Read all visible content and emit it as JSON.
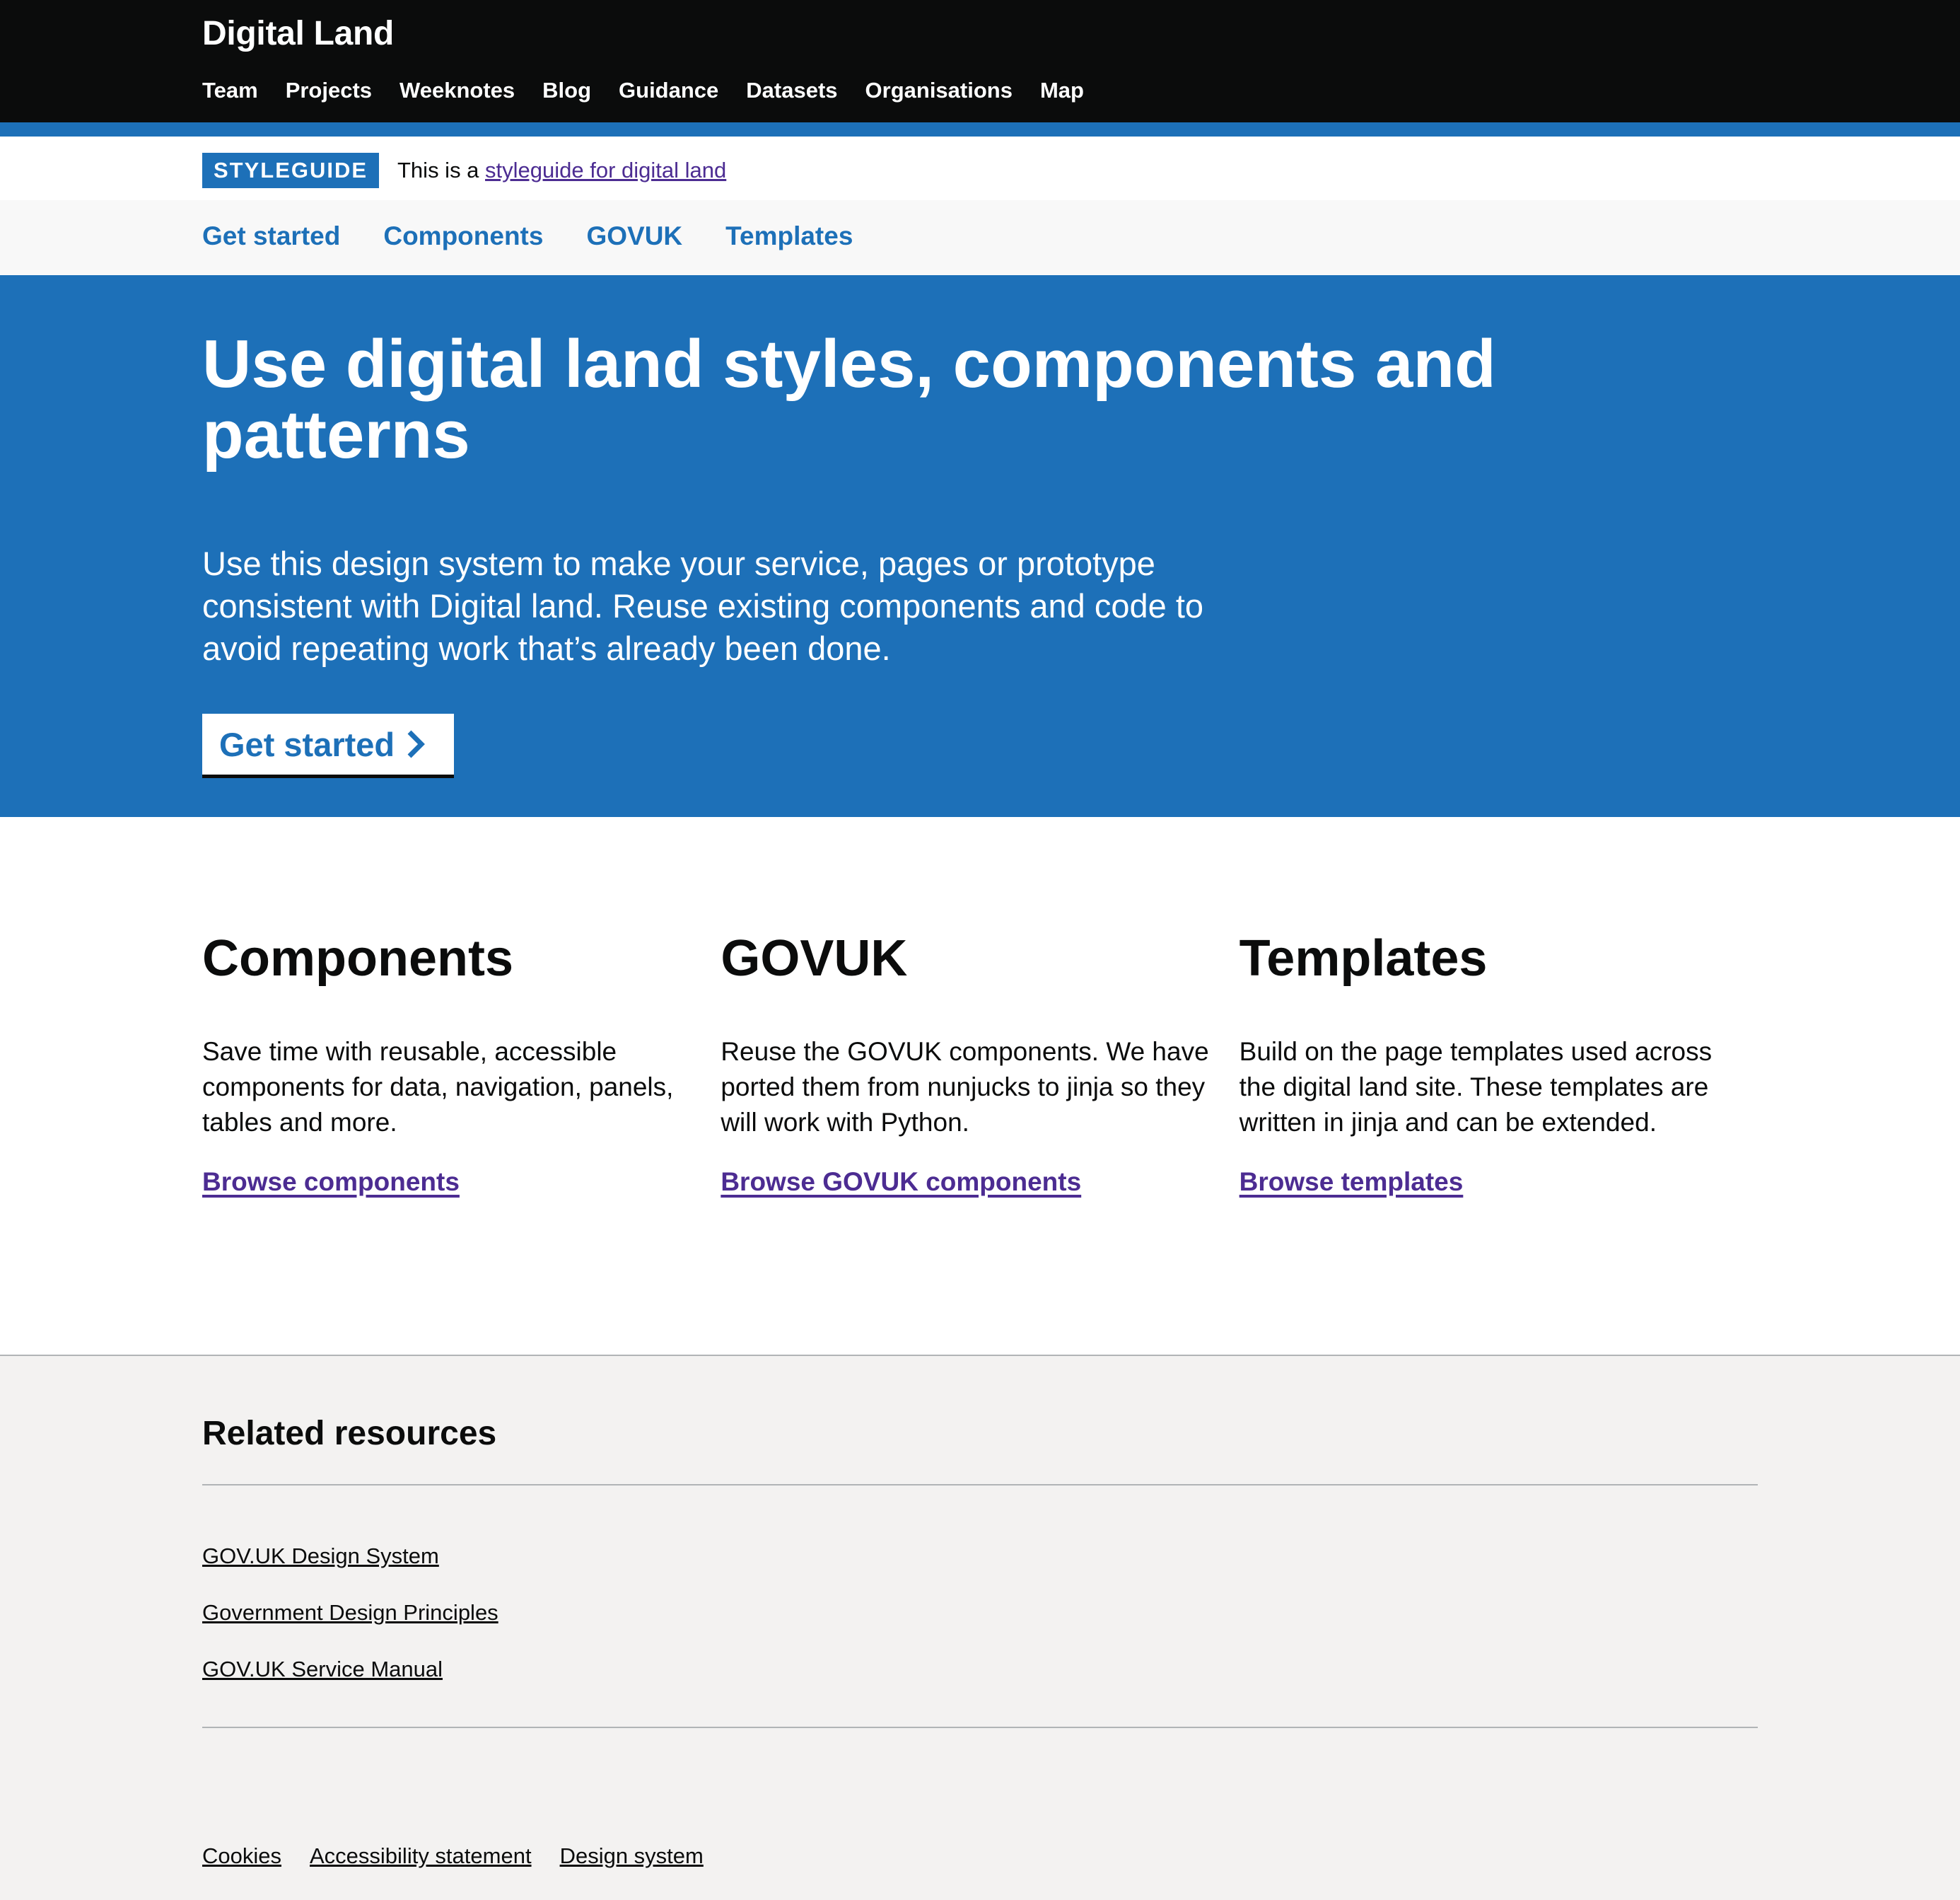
{
  "header": {
    "brand": "Digital Land",
    "nav": [
      {
        "label": "Team"
      },
      {
        "label": "Projects"
      },
      {
        "label": "Weeknotes"
      },
      {
        "label": "Blog"
      },
      {
        "label": "Guidance"
      },
      {
        "label": "Datasets"
      },
      {
        "label": "Organisations"
      },
      {
        "label": "Map"
      }
    ]
  },
  "banner": {
    "tag": "STYLEGUIDE",
    "text_prefix": "This is a ",
    "link_label": "styleguide for digital land"
  },
  "subnav": {
    "items": [
      {
        "label": "Get started"
      },
      {
        "label": "Components"
      },
      {
        "label": "GOVUK"
      },
      {
        "label": "Templates"
      }
    ]
  },
  "hero": {
    "title": "Use digital land styles, components and patterns",
    "description": "Use this design system to make your service, pages or prototype consistent with Digital land. Reuse existing components and code to avoid repeating work that’s already been done.",
    "button_label": "Get started",
    "button_icon": "chevron-right-icon"
  },
  "cards": [
    {
      "title": "Components",
      "description": "Save time with reusable, accessible components for data, navigation, panels, tables and more.",
      "link": "Browse components"
    },
    {
      "title": "GOVUK",
      "description": "Reuse the GOVUK components. We have ported them from nunjucks to jinja so they will work with Python.",
      "link": "Browse GOVUK components"
    },
    {
      "title": "Templates",
      "description": "Build on the page templates used across the digital land site. These templates are written in jinja and can be extended.",
      "link": "Browse templates"
    }
  ],
  "footer": {
    "heading": "Related resources",
    "resources": [
      {
        "label": "GOV.UK Design System"
      },
      {
        "label": "Government Design Principles"
      },
      {
        "label": "GOV.UK Service Manual"
      }
    ],
    "meta_links": [
      {
        "label": "Cookies"
      },
      {
        "label": "Accessibility statement"
      },
      {
        "label": "Design system"
      }
    ]
  },
  "colors": {
    "header_bg": "#0b0c0c",
    "brand_blue": "#1d70b8",
    "visited_link": "#4c2c92",
    "subnav_bg": "#f8f8f8",
    "footer_bg": "#f3f2f1",
    "rule": "#b1b4b6"
  }
}
